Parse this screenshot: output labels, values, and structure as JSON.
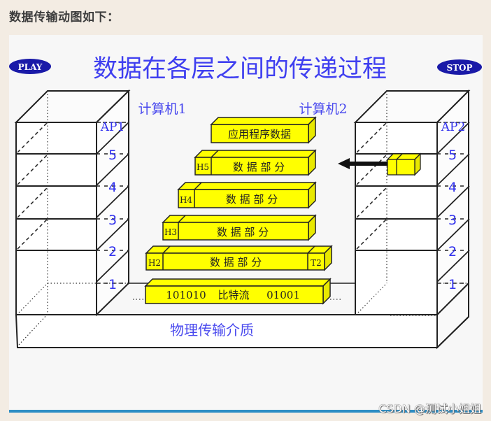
{
  "heading": "数据传输动图如下：",
  "diagram": {
    "title": "数据在各层之间的传递过程",
    "play_button": "PLAY",
    "stop_button": "STOP",
    "computer1_label": "计算机1",
    "computer2_label": "计算机2",
    "layers_left": [
      "AP1",
      "5",
      "4",
      "3",
      "2",
      "1"
    ],
    "layers_right": [
      "AP2",
      "5",
      "4",
      "3",
      "2",
      "1"
    ],
    "medium_label": "物理传输介质",
    "packets": {
      "app_data": "应用程序数据",
      "h5": {
        "header": "H5",
        "body": "数 据 部 分"
      },
      "h4": {
        "header": "H4",
        "body": "数 据 部 分"
      },
      "h3": {
        "header": "H3",
        "body": "数 据 部 分"
      },
      "h2": {
        "header": "H2",
        "body": "数 据 部 分",
        "trailer": "T2"
      },
      "bits": {
        "left": "101010",
        "middle": "比特流",
        "right": "01001"
      }
    },
    "colors": {
      "packet_fill": "#ffff00",
      "label_blue": "#3333ee",
      "play_stop_fill": "#1a1aa8"
    }
  },
  "watermark": "CSDN @测试小姐姐"
}
